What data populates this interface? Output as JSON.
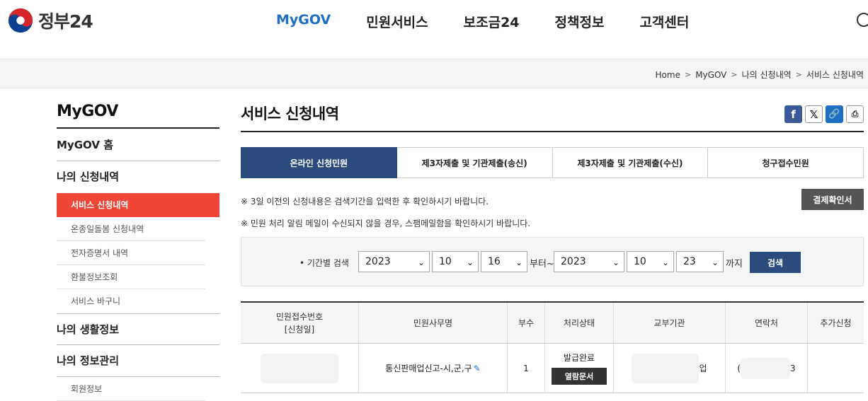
{
  "header": {
    "logo_text": "정부24",
    "nav": [
      {
        "label": "MyGOV",
        "active": true
      },
      {
        "label": "민원서비스",
        "active": false
      },
      {
        "label": "보조금24",
        "active": false
      },
      {
        "label": "정책정보",
        "active": false
      },
      {
        "label": "고객센터",
        "active": false
      }
    ]
  },
  "breadcrumb": [
    "Home",
    "MyGOV",
    "나의 신청내역",
    "서비스 신청내역"
  ],
  "sidebar": {
    "title": "MyGOV",
    "home": "MyGOV 홈",
    "section1": "나의 신청내역",
    "sub_items": [
      "서비스 신청내역",
      "온종일돌봄 신청내역",
      "전자증명서 내역",
      "환불정보조회",
      "서비스 바구니"
    ],
    "section2": "나의 생활정보",
    "section3": "나의 정보관리",
    "section3_sub": "회원정보"
  },
  "main": {
    "title": "서비스 신청내역",
    "share_icons": [
      "facebook-icon",
      "x-icon",
      "link-icon",
      "print-icon"
    ],
    "tabs": [
      "온라인 신청민원",
      "제3자제출 및 기관제출(송신)",
      "제3자제출 및 기관제출(수신)",
      "청구접수민원"
    ],
    "notice1": "※ 3일 이전의 신청내용은 검색기간을 입력한 후 확인하시기 바랍니다.",
    "notice2": "※ 민원 처리 알림 메일이 수신되지 않을 경우, 스팸메일함을 확인하시기 바랍니다.",
    "confirm_button": "결제확인서",
    "search": {
      "label": "• 기간별 검색",
      "from_year": "2023",
      "from_month": "10",
      "from_day": "16",
      "from_text": "부터~",
      "to_year": "2023",
      "to_month": "10",
      "to_day": "23",
      "to_text": "까지",
      "button": "검색"
    },
    "table": {
      "headers": [
        "민원접수번호",
        "[신청일]",
        "민원사무명",
        "부수",
        "처리상태",
        "교부기관",
        "연락처",
        "추가신청"
      ],
      "row": {
        "service_name": "통신판매업신고-시,군,구",
        "count": "1",
        "status": "발급완료",
        "view_button": "열람문서",
        "agency_partial": "업",
        "contact_start": "(",
        "contact_end": "3"
      }
    }
  },
  "colors": {
    "accent_blue": "#1d6fc4",
    "navy": "#2b4a7e",
    "active_red": "#f04637"
  }
}
